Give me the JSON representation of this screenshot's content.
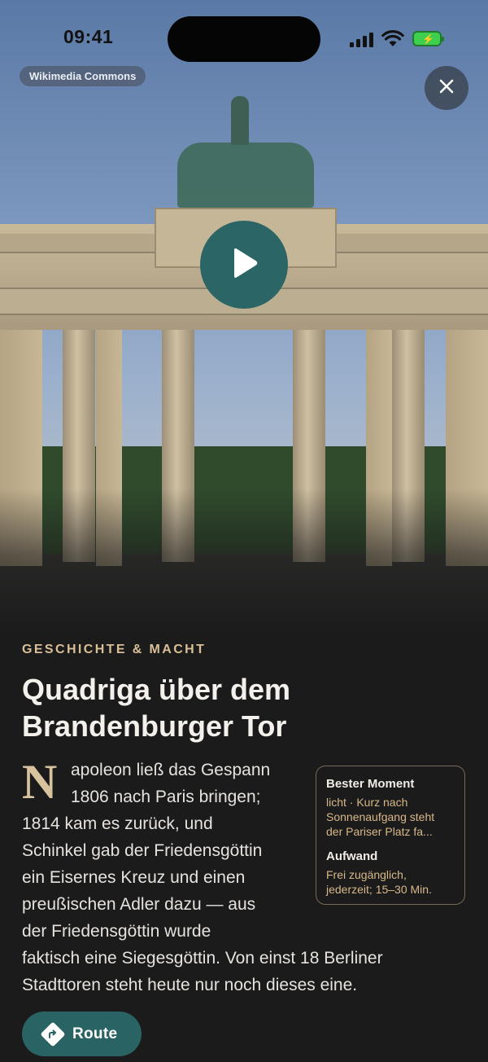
{
  "status_bar": {
    "time": "09:41"
  },
  "media": {
    "attribution": "Wikimedia Commons",
    "close_icon": "close-icon",
    "play_icon": "play-icon"
  },
  "article": {
    "kicker": "GESCHICHTE & MACHT",
    "title_line1": "Quadriga über dem",
    "title_line2": "Brandenburger Tor",
    "dropcap": "N",
    "body_lines": [
      "apoleon ließ das Gespann",
      "1806 nach Paris bringen;",
      "1814 kam es zurück, und",
      "Schinkel gab der Friedensgöttin",
      "ein Eisernes Kreuz und einen",
      "preußischen Adler dazu — aus",
      "der Friedensgöttin wurde",
      "faktisch eine Siegesgöttin. Von einst 18 Berliner",
      "Stadttoren steht heute nur noch dieses eine."
    ]
  },
  "infobox": {
    "best_moment_heading": "Bester Moment",
    "best_moment_line1": "licht · Kurz nach",
    "best_moment_line2": "Sonnenaufgang steht",
    "best_moment_line3": "der Pariser Platz fa...",
    "effort_heading": "Aufwand",
    "effort_line1": "Frei zugänglich,",
    "effort_line2": "jederzeit; 15–30 Min."
  },
  "actions": {
    "route_label": "Route",
    "route_icon": "directions-icon"
  },
  "colors": {
    "accent": "#2a6363",
    "kicker": "#d9bf97",
    "background": "#1b1b1b"
  }
}
